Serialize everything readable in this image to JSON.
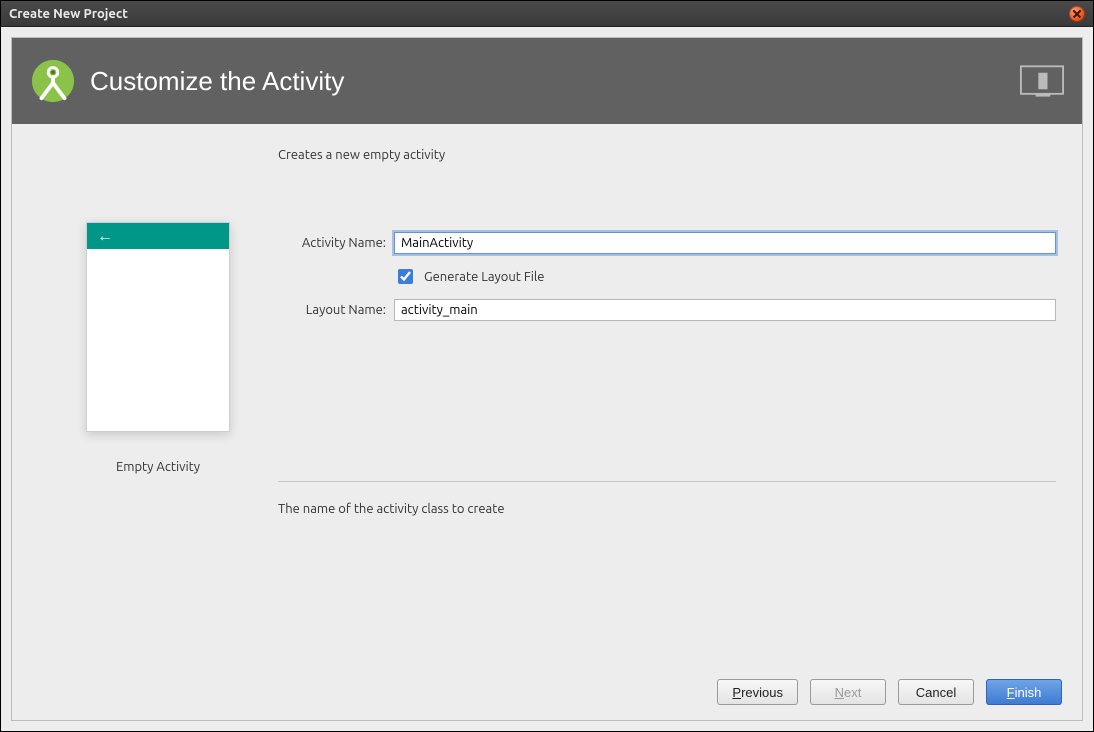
{
  "window": {
    "title": "Create New Project"
  },
  "header": {
    "title": "Customize the Activity"
  },
  "description": "Creates a new empty activity",
  "preview": {
    "caption": "Empty Activity"
  },
  "fields": {
    "activity_name": {
      "label": "Activity Name:",
      "value": "MainActivity"
    },
    "generate_layout": {
      "label": "Generate Layout File",
      "checked": true
    },
    "layout_name": {
      "label": "Layout Name:",
      "value": "activity_main"
    }
  },
  "help_text": "The name of the activity class to create",
  "buttons": {
    "previous": "Previous",
    "next": "Next",
    "cancel": "Cancel",
    "finish": "Finish"
  }
}
